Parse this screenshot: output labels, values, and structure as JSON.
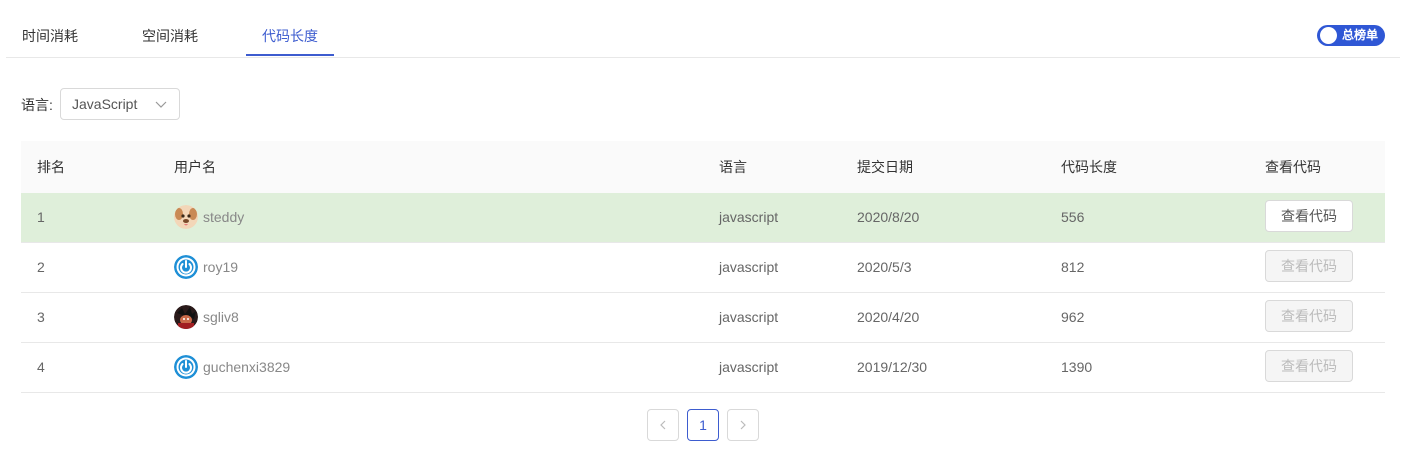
{
  "tabs": [
    {
      "label": "时间消耗",
      "active": false
    },
    {
      "label": "空间消耗",
      "active": false
    },
    {
      "label": "代码长度",
      "active": true
    }
  ],
  "toggle": {
    "label": "总榜单",
    "on": true,
    "color": "#2f57d5"
  },
  "filter": {
    "label": "语言:",
    "selected": "JavaScript"
  },
  "table": {
    "headers": [
      "排名",
      "用户名",
      "语言",
      "提交日期",
      "代码长度",
      "查看代码"
    ],
    "rows": [
      {
        "rank": "1",
        "user": "steddy",
        "avatar": "dog-avatar",
        "lang": "javascript",
        "date": "2020/8/20",
        "length": "556",
        "action": "查看代码",
        "highlighted": true,
        "action_enabled": true
      },
      {
        "rank": "2",
        "user": "roy19",
        "avatar": "power-avatar",
        "lang": "javascript",
        "date": "2020/5/3",
        "length": "812",
        "action": "查看代码",
        "highlighted": false,
        "action_enabled": false
      },
      {
        "rank": "3",
        "user": "sgliv8",
        "avatar": "character-avatar",
        "lang": "javascript",
        "date": "2020/4/20",
        "length": "962",
        "action": "查看代码",
        "highlighted": false,
        "action_enabled": false
      },
      {
        "rank": "4",
        "user": "guchenxi3829",
        "avatar": "power-avatar",
        "lang": "javascript",
        "date": "2019/12/30",
        "length": "1390",
        "action": "查看代码",
        "highlighted": false,
        "action_enabled": false
      }
    ]
  },
  "pagination": {
    "prev_icon": "chevron-left-icon",
    "current": "1",
    "next_icon": "chevron-right-icon"
  },
  "colors": {
    "accent": "#3d5ccf",
    "highlight_row": "#dfefda",
    "toggle": "#2f57d5"
  }
}
